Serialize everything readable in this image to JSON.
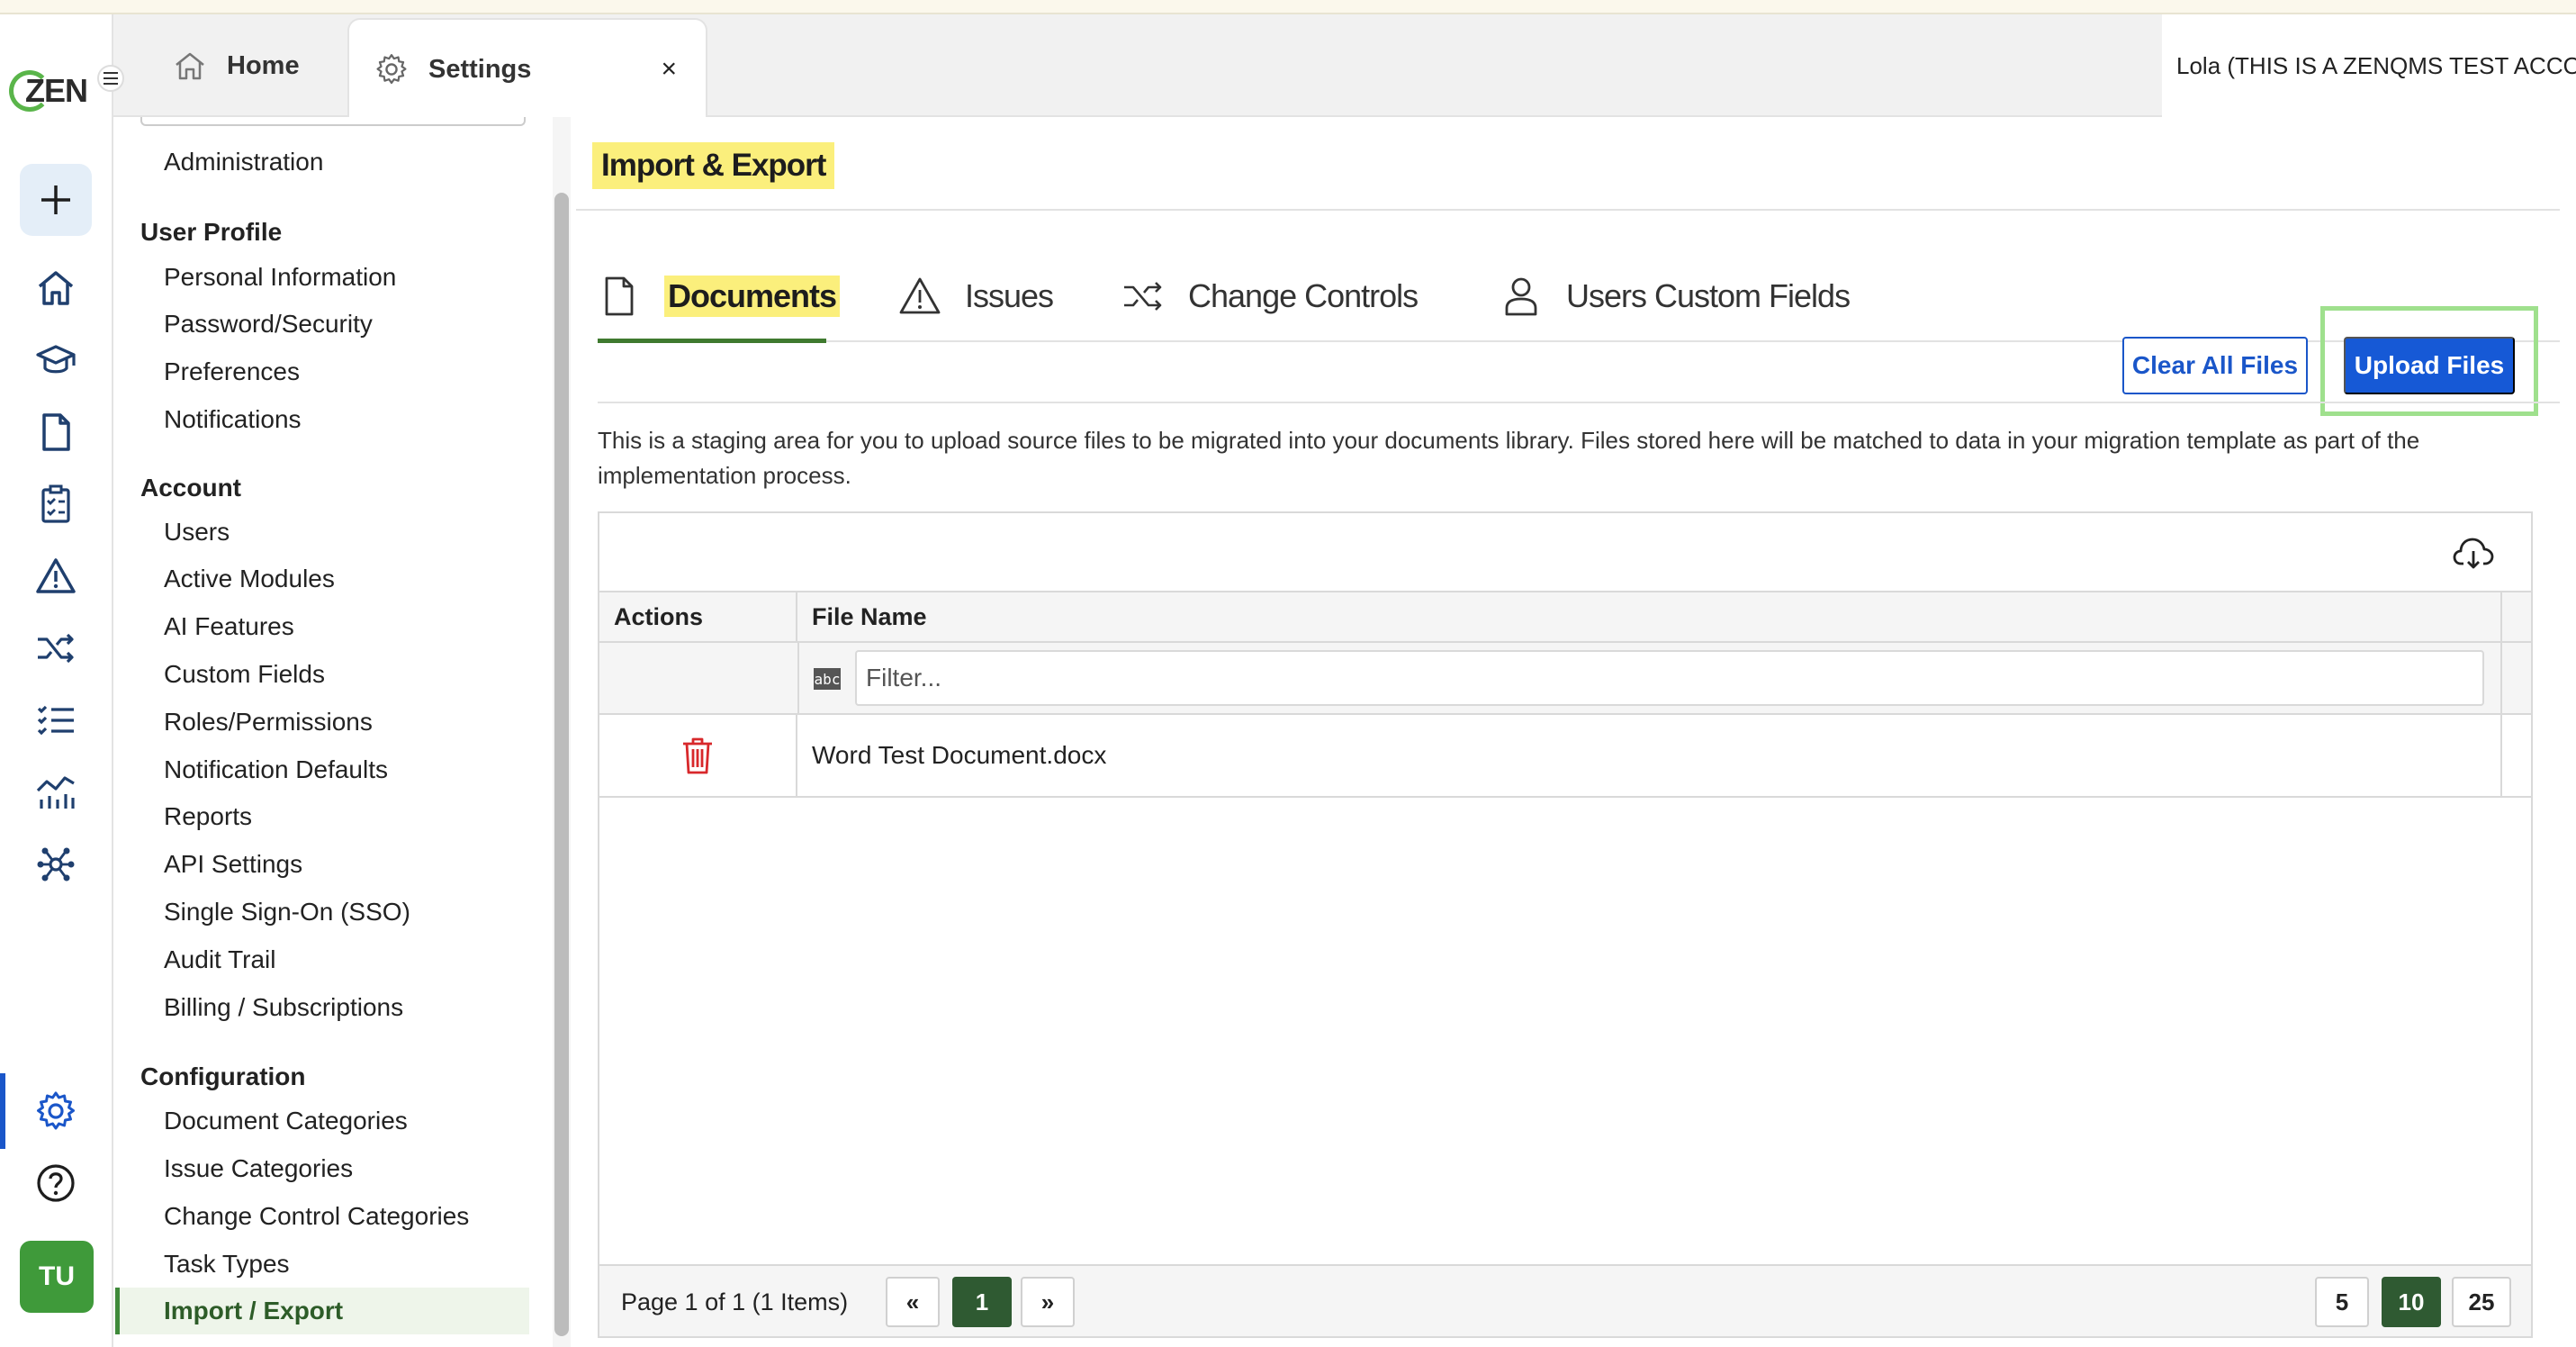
{
  "tabs": {
    "home_label": "Home",
    "settings_label": "Settings",
    "close_glyph": "×"
  },
  "account": {
    "label": "Lola (THIS IS A ZENQMS TEST ACCOUNT)"
  },
  "logo": {
    "text": "ZEN"
  },
  "avatar": {
    "initials": "TU"
  },
  "nav": {
    "admin": "Administration",
    "user_profile": {
      "title": "User Profile",
      "items": [
        "Personal Information",
        "Password/Security",
        "Preferences",
        "Notifications"
      ]
    },
    "account": {
      "title": "Account",
      "items": [
        "Users",
        "Active Modules",
        "AI Features",
        "Custom Fields",
        "Roles/Permissions",
        "Notification Defaults",
        "Reports",
        "API Settings",
        "Single Sign-On (SSO)",
        "Audit Trail",
        "Billing / Subscriptions"
      ]
    },
    "configuration": {
      "title": "Configuration",
      "items": [
        "Document Categories",
        "Issue Categories",
        "Change Control Categories",
        "Task Types",
        "Import / Export"
      ],
      "active": "Import / Export"
    }
  },
  "page": {
    "title": "Import & Export",
    "tabs": [
      "Documents",
      "Issues",
      "Change Controls",
      "Users Custom Fields"
    ],
    "active_tab": "Documents",
    "clear_button": "Clear All Files",
    "upload_button": "Upload Files",
    "description": "This is a staging area for you to upload source files to be migrated into your documents library. Files stored here will be matched to data in your migration template as part of the implementation process."
  },
  "grid": {
    "columns": [
      "Actions",
      "File Name"
    ],
    "filter_placeholder": "Filter...",
    "filter_badge": "abc",
    "rows": [
      {
        "file_name": "Word Test Document.docx"
      }
    ],
    "pager": {
      "info": "Page 1 of 1 (1 Items)",
      "prev": "«",
      "current": "1",
      "next": "»",
      "sizes": [
        "5",
        "10",
        "25"
      ],
      "selected_size": "10"
    }
  },
  "colors": {
    "accent_blue": "#1659d6",
    "highlight_yellow": "#fbef7c",
    "active_green": "#2f5a32",
    "upload_highlight": "#9fe08d",
    "delete_red": "#d8282b"
  },
  "icons": {
    "rail": [
      "plus-icon",
      "home-icon",
      "training-icon",
      "document-icon",
      "checklist-icon",
      "issue-icon",
      "change-control-icon",
      "tasks-icon",
      "analytics-icon",
      "network-icon",
      "gear-icon",
      "help-icon"
    ]
  }
}
